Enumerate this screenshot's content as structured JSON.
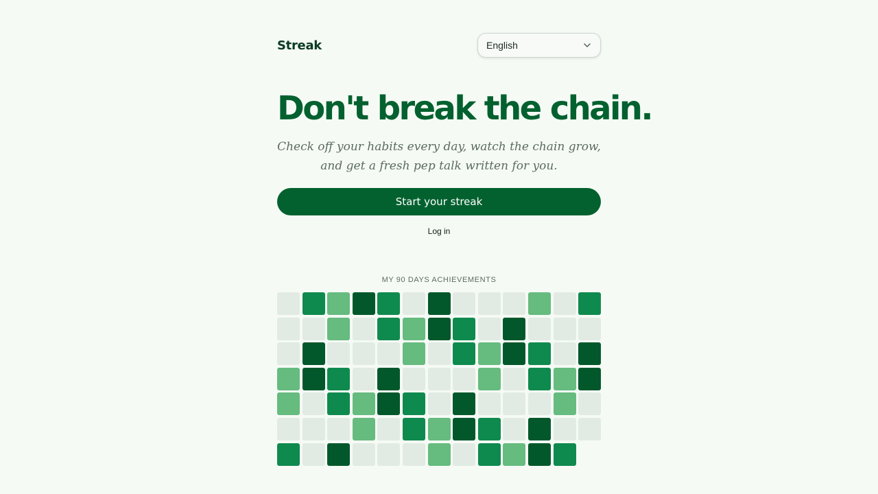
{
  "header": {
    "brand": "Streak",
    "language": {
      "selected": "English",
      "icon": "chevron-down-icon"
    }
  },
  "hero": {
    "title": "Don't break the chain.",
    "subtitle_line1": "Check off your habits every day, watch the chain grow,",
    "subtitle_line2": "and get a fresh pep talk written for you.",
    "cta_label": "Start your streak",
    "login_label": "Log in"
  },
  "achievements": {
    "label": "MY 90 DAYS ACHIEVEMENTS",
    "columns": 13,
    "levels": [
      0,
      2,
      1,
      3,
      2,
      0,
      3,
      0,
      0,
      0,
      1,
      0,
      2,
      0,
      0,
      1,
      0,
      2,
      1,
      3,
      2,
      0,
      3,
      0,
      0,
      0,
      0,
      3,
      0,
      0,
      0,
      1,
      0,
      2,
      1,
      3,
      2,
      0,
      3,
      1,
      3,
      2,
      0,
      3,
      0,
      0,
      0,
      1,
      0,
      2,
      1,
      3,
      1,
      0,
      2,
      1,
      3,
      2,
      0,
      3,
      0,
      0,
      0,
      1,
      0,
      0,
      0,
      0,
      1,
      0,
      2,
      1,
      3,
      2,
      0,
      3,
      0,
      0,
      2,
      0,
      3,
      0,
      0,
      0,
      1,
      0,
      2,
      1,
      3,
      2
    ],
    "colors": {
      "empty": "#e1ebe3",
      "light": "#66bb7f",
      "medium": "#0f8a4e",
      "dark": "#03582b"
    }
  },
  "theme": {
    "background": "#f5faf5",
    "accent": "#03612f"
  }
}
